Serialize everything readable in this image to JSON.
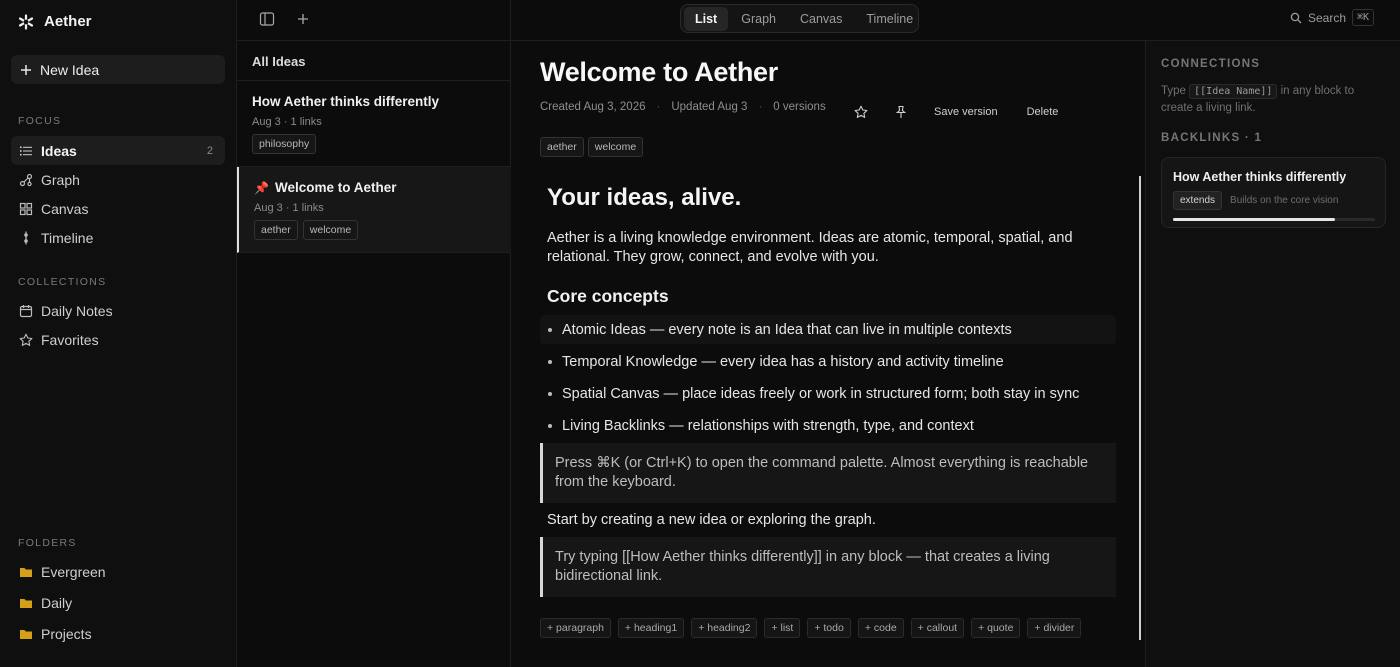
{
  "app": {
    "name": "Aether",
    "logo_icon": "aether-logo-icon"
  },
  "sidebar": {
    "new_idea_label": "New Idea",
    "focus_label": "FOCUS",
    "focus_items": [
      {
        "label": "Ideas",
        "icon": "list-icon",
        "count": "2",
        "active": true
      },
      {
        "label": "Graph",
        "icon": "graph-icon"
      },
      {
        "label": "Canvas",
        "icon": "grid-icon"
      },
      {
        "label": "Timeline",
        "icon": "timeline-icon"
      }
    ],
    "collections_label": "COLLECTIONS",
    "collections": [
      {
        "label": "Daily Notes",
        "icon": "calendar-icon"
      },
      {
        "label": "Favorites",
        "icon": "star-icon"
      }
    ],
    "folders_label": "FOLDERS",
    "folders": [
      {
        "label": "Evergreen",
        "icon": "folder-icon"
      },
      {
        "label": "Daily",
        "icon": "folder-icon"
      },
      {
        "label": "Projects",
        "icon": "folder-icon"
      }
    ],
    "folder_color": "#d4a017"
  },
  "list": {
    "header": "All Ideas",
    "cards": [
      {
        "title": "How Aether thinks differently",
        "date": "Aug 3",
        "links": "· 1 links",
        "tags": [
          "philosophy"
        ],
        "pinned": false
      },
      {
        "title": "Welcome to Aether",
        "date": "Aug 3",
        "links": "· 1 links",
        "tags": [
          "aether",
          "welcome"
        ],
        "pinned": true,
        "pin_glyph": "📌"
      }
    ]
  },
  "tabs": [
    {
      "label": "List",
      "active": true
    },
    {
      "label": "Graph"
    },
    {
      "label": "Canvas"
    },
    {
      "label": "Timeline"
    }
  ],
  "search": {
    "label": "Search",
    "shortcut": "⌘K"
  },
  "doc": {
    "title": "Welcome to Aether",
    "created": "Created Aug 3, 2026",
    "updated": "Updated Aug 3",
    "versions": "0 versions",
    "save_version": "Save version",
    "delete": "Delete",
    "tags": [
      "aether",
      "welcome"
    ],
    "h1": "Your ideas, alive.",
    "intro": "Aether is a living knowledge environment. Ideas are atomic, temporal, spatial, and relational. They grow, connect, and evolve with you.",
    "h2": "Core concepts",
    "bullets": [
      "Atomic Ideas — every note is an Idea that can live in multiple contexts",
      "Temporal Knowledge — every idea has a history and activity timeline",
      "Spatial Canvas — place ideas freely or work in structured form; both stay in sync",
      "Living Backlinks — relationships with strength, type, and context"
    ],
    "callout1": "Press ⌘K (or Ctrl+K) to open the command palette. Almost everything is reachable from the keyboard.",
    "start": "Start by creating a new idea or exploring the graph.",
    "callout2": "Try typing [[How Aether thinks differently]] in any block — that creates a living bidirectional link.",
    "inserts": [
      "+ paragraph",
      "+ heading1",
      "+ heading2",
      "+ list",
      "+ todo",
      "+ code",
      "+ callout",
      "+ quote",
      "+ divider"
    ]
  },
  "right": {
    "connections_label": "CONNECTIONS",
    "hint_prefix": "Type",
    "hint_code": "[[Idea Name]]",
    "hint_suffix": "in any block to create a living link.",
    "backlinks_label": "BACKLINKS · 1",
    "backlink": {
      "title": "How Aether thinks differently",
      "type": "extends",
      "desc": "Builds on the core vision",
      "strength": 0.8
    }
  }
}
